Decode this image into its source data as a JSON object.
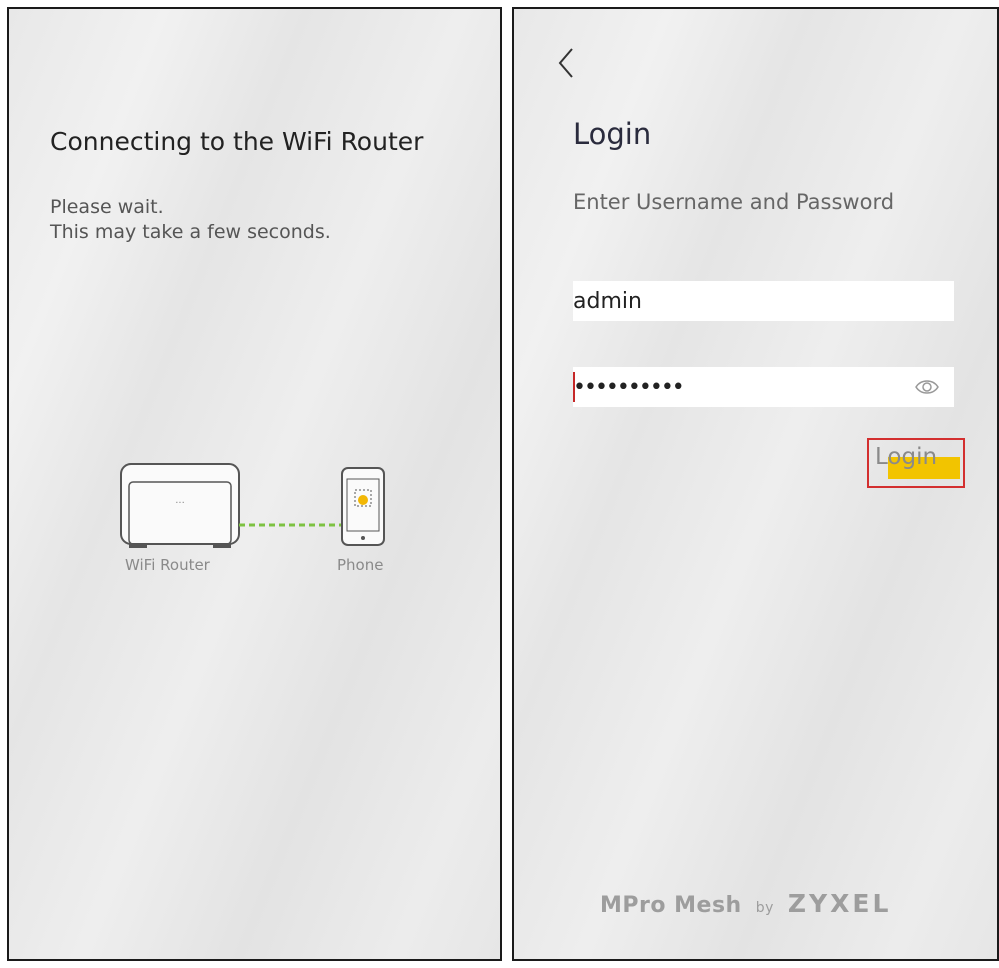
{
  "left_screen": {
    "title": "Connecting to the WiFi Router",
    "line1": "Please wait.",
    "line2": "This may take a few seconds.",
    "router_label": "WiFi Router",
    "phone_label": "Phone",
    "router_dots": "...",
    "link_color": "#7dc242",
    "accent_color": "#f2b705"
  },
  "right_screen": {
    "back_icon": "chevron-left-icon",
    "title": "Login",
    "subtitle": "Enter Username and Password",
    "username_value": "admin",
    "password_value": "••••••••••",
    "eye_icon": "eye-icon",
    "login_button": "Login",
    "highlight_color": "#f2c400",
    "box_color": "#d32f2f",
    "brand": {
      "name": "MPro Mesh",
      "by": "by",
      "company": "ZYXEL"
    }
  }
}
